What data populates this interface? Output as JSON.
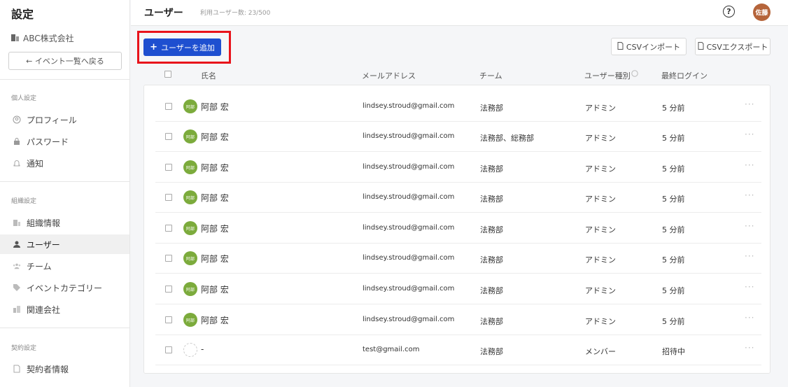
{
  "sidebar": {
    "title": "設定",
    "org_name": "ABC株式会社",
    "back_label": "← イベント一覧へ戻る",
    "sections": [
      {
        "label": "個人設定",
        "items": [
          {
            "label": "プロフィール",
            "icon": "profile-icon"
          },
          {
            "label": "パスワード",
            "icon": "lock-icon"
          },
          {
            "label": "通知",
            "icon": "bell-icon"
          }
        ]
      },
      {
        "label": "組織設定",
        "items": [
          {
            "label": "組織情報",
            "icon": "building-icon"
          },
          {
            "label": "ユーザー",
            "icon": "user-icon",
            "active": true
          },
          {
            "label": "チーム",
            "icon": "team-icon"
          },
          {
            "label": "イベントカテゴリー",
            "icon": "tag-icon"
          },
          {
            "label": "関連会社",
            "icon": "company-icon"
          }
        ]
      },
      {
        "label": "契約設定",
        "items": [
          {
            "label": "契約者情報",
            "icon": "document-icon"
          }
        ]
      }
    ]
  },
  "header": {
    "title": "ユーザー",
    "usage": "利用ユーザー数: 23/500",
    "help_symbol": "?",
    "avatar_text": "佐藤"
  },
  "toolbar": {
    "add_label": "ユーザーを追加",
    "add_symbol": "+",
    "csv_import": "CSVインポート",
    "csv_export": "CSVエクスポート"
  },
  "table": {
    "columns": {
      "name": "氏名",
      "email": "メールアドレス",
      "team": "チーム",
      "type": "ユーザー種別",
      "last_login": "最終ログイン"
    },
    "rows": [
      {
        "avatar": "阿部",
        "name": "阿部 宏",
        "email": "lindsey.stroud@gmail.com",
        "team": "法務部",
        "type": "アドミン",
        "last_login": "5 分前"
      },
      {
        "avatar": "阿部",
        "name": "阿部 宏",
        "email": "lindsey.stroud@gmail.com",
        "team": "法務部、総務部",
        "type": "アドミン",
        "last_login": "5 分前"
      },
      {
        "avatar": "阿部",
        "name": "阿部 宏",
        "email": "lindsey.stroud@gmail.com",
        "team": "法務部",
        "type": "アドミン",
        "last_login": "5 分前"
      },
      {
        "avatar": "阿部",
        "name": "阿部 宏",
        "email": "lindsey.stroud@gmail.com",
        "team": "法務部",
        "type": "アドミン",
        "last_login": "5 分前"
      },
      {
        "avatar": "阿部",
        "name": "阿部 宏",
        "email": "lindsey.stroud@gmail.com",
        "team": "法務部",
        "type": "アドミン",
        "last_login": "5 分前"
      },
      {
        "avatar": "阿部",
        "name": "阿部 宏",
        "email": "lindsey.stroud@gmail.com",
        "team": "法務部",
        "type": "アドミン",
        "last_login": "5 分前"
      },
      {
        "avatar": "阿部",
        "name": "阿部 宏",
        "email": "lindsey.stroud@gmail.com",
        "team": "法務部",
        "type": "アドミン",
        "last_login": "5 分前"
      },
      {
        "avatar": "阿部",
        "name": "阿部 宏",
        "email": "lindsey.stroud@gmail.com",
        "team": "法務部",
        "type": "アドミン",
        "last_login": "5 分前"
      },
      {
        "avatar": "",
        "name": "-",
        "email": "test@gmail.com",
        "team": "法務部",
        "type": "メンバー",
        "last_login": "招待中"
      }
    ],
    "more_symbol": "···"
  },
  "colors": {
    "accent": "#1e4fd0",
    "highlight": "#e8131b",
    "avatar_green": "#7cab3c",
    "user_avatar": "#b5643a"
  }
}
